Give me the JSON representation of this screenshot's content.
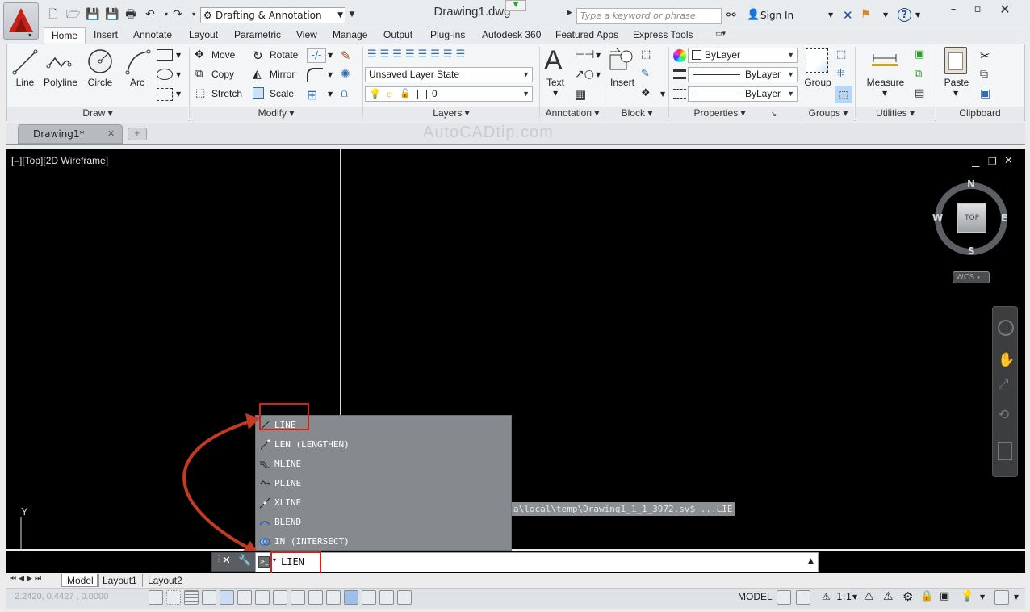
{
  "title_bar": {
    "workspace": "Drafting & Annotation",
    "document_title": "Drawing1.dwg",
    "search_placeholder": "Type a keyword or phrase",
    "sign_in": "Sign In"
  },
  "ribbon_tabs": [
    "Home",
    "Insert",
    "Annotate",
    "Layout",
    "Parametric",
    "View",
    "Manage",
    "Output",
    "Plug-ins",
    "Autodesk 360",
    "Featured Apps",
    "Express Tools"
  ],
  "draw_panel": {
    "title": "Draw",
    "line": "Line",
    "polyline": "Polyline",
    "circle": "Circle",
    "arc": "Arc"
  },
  "modify_panel": {
    "title": "Modify",
    "move": "Move",
    "rotate": "Rotate",
    "copy": "Copy",
    "mirror": "Mirror",
    "stretch": "Stretch",
    "scale": "Scale"
  },
  "layers_panel": {
    "title": "Layers",
    "layer_state": "Unsaved Layer State",
    "current_layer": "0"
  },
  "annotation_panel": {
    "title": "Annotation",
    "text": "Text"
  },
  "block_panel": {
    "title": "Block",
    "insert": "Insert"
  },
  "properties_panel": {
    "title": "Properties",
    "color": "ByLayer",
    "linetype": "ByLayer",
    "lineweight": "ByLayer"
  },
  "groups_panel": {
    "title": "Groups",
    "group": "Group"
  },
  "utilities_panel": {
    "title": "Utilities",
    "measure": "Measure"
  },
  "clipboard_panel": {
    "title": "Clipboard",
    "paste": "Paste"
  },
  "doc_tab": "Drawing1*",
  "watermark": "AutoCADtip.com",
  "viewport": {
    "label": "[–][Top][2D Wireframe]",
    "viewcube": {
      "n": "N",
      "s": "S",
      "e": "E",
      "w": "W",
      "face": "TOP",
      "ucs": "WCS"
    },
    "ucs_y": "Y"
  },
  "autocomplete": [
    {
      "label": "LINE"
    },
    {
      "label": "LEN (LENGTHEN)"
    },
    {
      "label": "MLINE"
    },
    {
      "label": "PLINE"
    },
    {
      "label": "XLINE"
    },
    {
      "label": "BLEND"
    },
    {
      "label": "IN (INTERSECT)"
    }
  ],
  "history_text": "a\\local\\temp\\Drawing1_1_1_3972.sv$ ...LIE",
  "command_line": {
    "value": "LIEN"
  },
  "layout_tabs": [
    "Model",
    "Layout1",
    "Layout2"
  ],
  "status_bar": {
    "coords": "2.2420, 0.4427 , 0.0000",
    "model": "MODEL",
    "scale": "1:1"
  },
  "colors": {
    "accent_red": "#d1231c",
    "viewport_bg": "#000000",
    "autocomplete_bg": "#868a8e"
  }
}
